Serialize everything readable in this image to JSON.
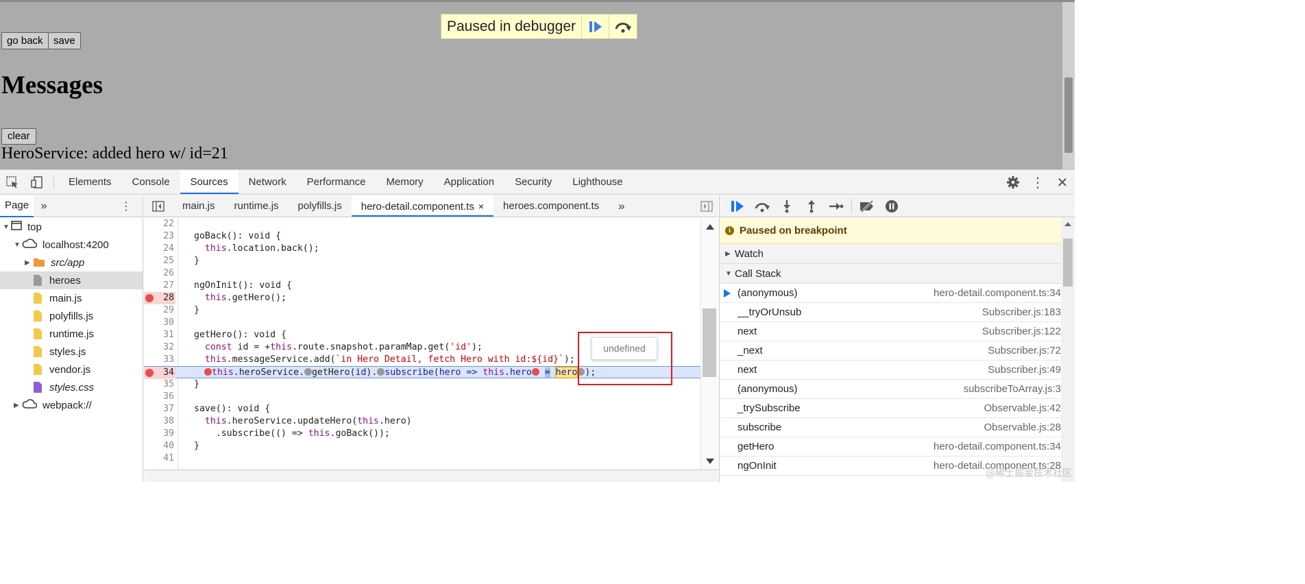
{
  "page": {
    "go_back": "go back",
    "save": "save",
    "heading": "Messages",
    "clear": "clear",
    "message": "HeroService: added hero w/ id=21",
    "paused_banner": "Paused in debugger"
  },
  "devtools": {
    "tabs": [
      "Elements",
      "Console",
      "Sources",
      "Network",
      "Performance",
      "Memory",
      "Application",
      "Security",
      "Lighthouse"
    ],
    "active_tab": "Sources",
    "navigator": {
      "tab": "Page",
      "more": "»",
      "tree": [
        {
          "label": "top",
          "icon": "frame-icon",
          "expanded": true
        },
        {
          "label": "localhost:4200",
          "icon": "cloud-icon",
          "expanded": true
        },
        {
          "label": "src/app",
          "icon": "folder-icon",
          "italic": true
        },
        {
          "label": "heroes",
          "icon": "doc-gray-icon",
          "selected": true
        },
        {
          "label": "main.js",
          "icon": "js-file-icon"
        },
        {
          "label": "polyfills.js",
          "icon": "js-file-icon"
        },
        {
          "label": "runtime.js",
          "icon": "js-file-icon"
        },
        {
          "label": "styles.js",
          "icon": "js-file-icon"
        },
        {
          "label": "vendor.js",
          "icon": "js-file-icon"
        },
        {
          "label": "styles.css",
          "icon": "css-file-icon",
          "italic": true
        },
        {
          "label": "webpack://",
          "icon": "cloud-icon",
          "expanded": false
        }
      ]
    },
    "file_tabs": [
      "main.js",
      "runtime.js",
      "polyfills.js",
      "hero-detail.component.ts",
      "heroes.component.ts"
    ],
    "file_tab_close": "×",
    "file_tab_more": "»",
    "active_file": "hero-detail.component.ts",
    "code_lines": [
      {
        "n": "22",
        "text": ""
      },
      {
        "n": "23",
        "text": "goBack(): void {"
      },
      {
        "n": "24",
        "text": "  this.location.back();"
      },
      {
        "n": "25",
        "text": "}"
      },
      {
        "n": "26",
        "text": ""
      },
      {
        "n": "27",
        "text": "ngOnInit(): void {"
      },
      {
        "n": "28",
        "text": "  this.getHero();",
        "breakpoint": true
      },
      {
        "n": "29",
        "text": "}"
      },
      {
        "n": "30",
        "text": ""
      },
      {
        "n": "31",
        "text": "getHero(): void {"
      },
      {
        "n": "32",
        "text": "  const id = +this.route.snapshot.paramMap.get('id');"
      },
      {
        "n": "33",
        "text": "  this.messageService.add(`in Hero Detail, fetch Hero with id:${id}`);"
      },
      {
        "n": "34",
        "text": "  this.heroService.getHero(id).subscribe(hero => this.hero = hero);",
        "breakpoint": true,
        "current": true
      },
      {
        "n": "35",
        "text": "}"
      },
      {
        "n": "36",
        "text": ""
      },
      {
        "n": "37",
        "text": "save(): void {"
      },
      {
        "n": "38",
        "text": "  this.heroService.updateHero(this.hero)"
      },
      {
        "n": "39",
        "text": "    .subscribe(() => this.goBack());"
      },
      {
        "n": "40",
        "text": "}"
      },
      {
        "n": "41",
        "text": ""
      }
    ],
    "tooltip": "undefined",
    "debugger": {
      "pause_message": "Paused on breakpoint",
      "watch": "Watch",
      "call_stack": "Call Stack",
      "frames": [
        {
          "fn": "(anonymous)",
          "loc": "hero-detail.component.ts:34",
          "current": true
        },
        {
          "fn": "__tryOrUnsub",
          "loc": "Subscriber.js:183"
        },
        {
          "fn": "next",
          "loc": "Subscriber.js:122"
        },
        {
          "fn": "_next",
          "loc": "Subscriber.js:72"
        },
        {
          "fn": "next",
          "loc": "Subscriber.js:49"
        },
        {
          "fn": "(anonymous)",
          "loc": "subscribeToArray.js:3"
        },
        {
          "fn": "_trySubscribe",
          "loc": "Observable.js:42"
        },
        {
          "fn": "subscribe",
          "loc": "Observable.js:28"
        },
        {
          "fn": "getHero",
          "loc": "hero-detail.component.ts:34"
        },
        {
          "fn": "ngOnInit",
          "loc": "hero-detail.component.ts:28"
        }
      ]
    },
    "watermark": "@稀土掘金技术社区"
  },
  "colors": {
    "accent": "#1a73e8",
    "breakpoint": "#e94c4c",
    "highlight_box": "#e1191d"
  }
}
